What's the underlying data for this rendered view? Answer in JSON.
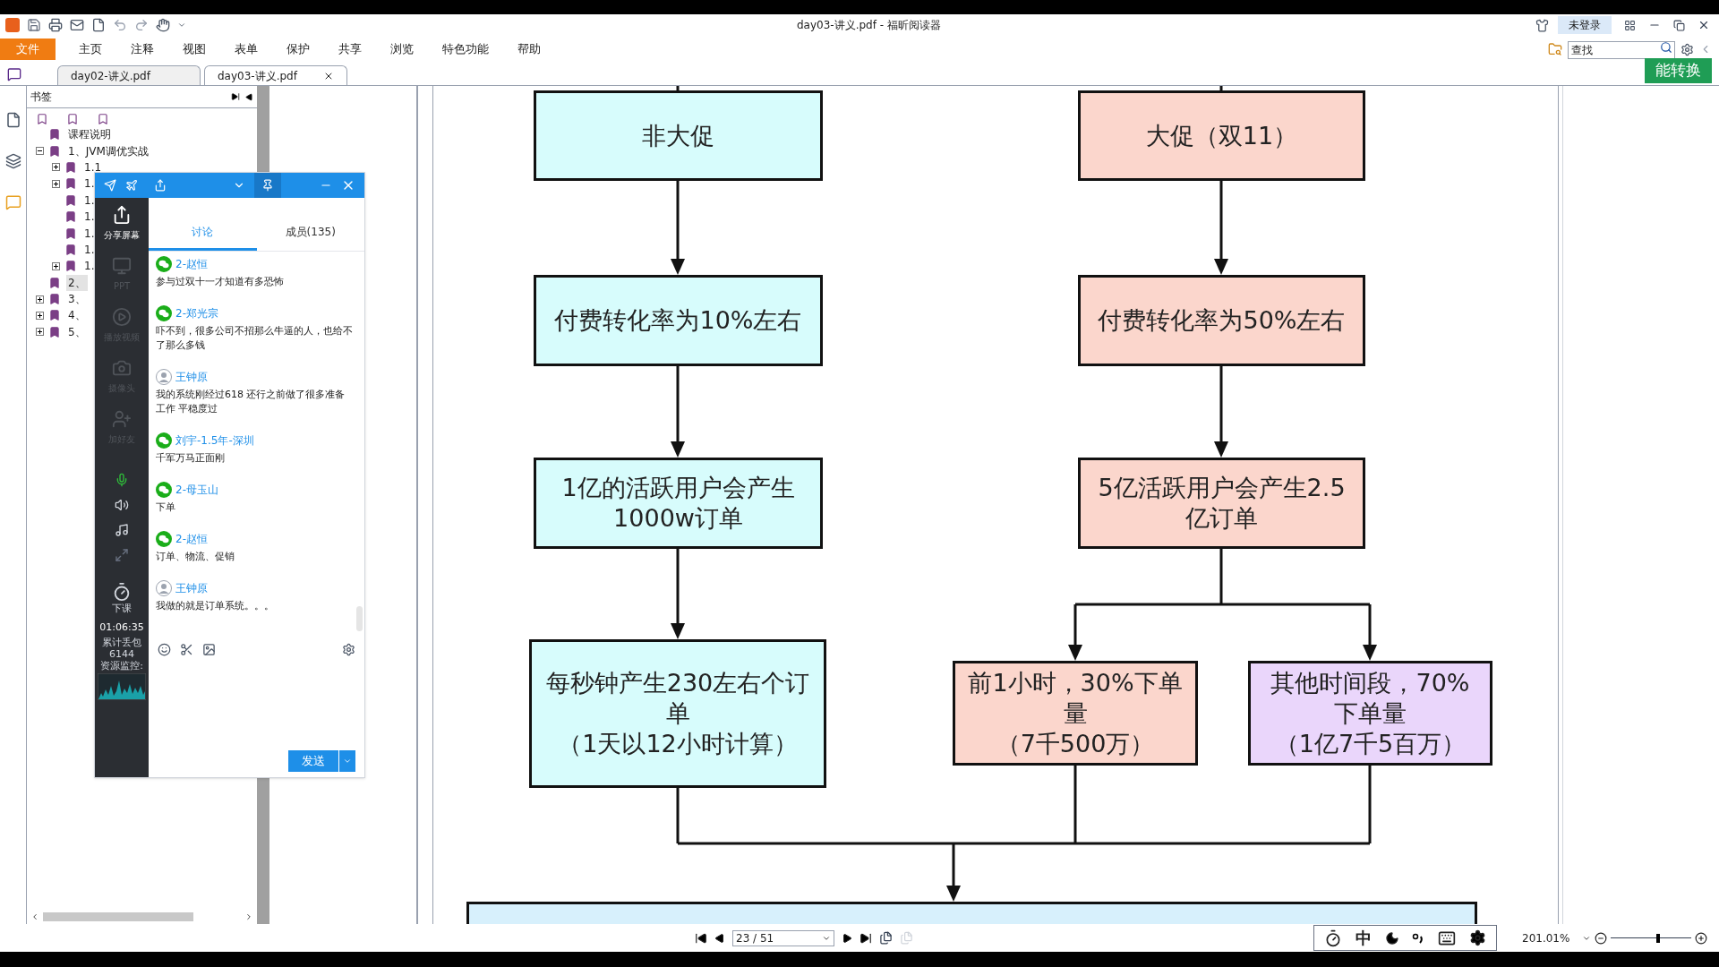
{
  "window": {
    "title": "day03-讲义.pdf - 福昕阅读器",
    "login": "未登录"
  },
  "menu": [
    {
      "label": "文件",
      "kind": "file"
    },
    {
      "label": "主页",
      "kind": "menu"
    },
    {
      "label": "注释",
      "kind": "menu"
    },
    {
      "label": "视图",
      "kind": "menu"
    },
    {
      "label": "表单",
      "kind": "menu"
    },
    {
      "label": "保护",
      "kind": "menu"
    },
    {
      "label": "共享",
      "kind": "menu"
    },
    {
      "label": "浏览",
      "kind": "menu"
    },
    {
      "label": "特色功能",
      "kind": "menu"
    },
    {
      "label": "帮助",
      "kind": "menu"
    }
  ],
  "search": {
    "placeholder": "查找"
  },
  "convert_button": "能转换",
  "doc_tabs": [
    {
      "label": "day02-讲义.pdf",
      "selected": false
    },
    {
      "label": "day03-讲义.pdf",
      "selected": true
    }
  ],
  "bookmarks": {
    "title": "书签",
    "items": [
      {
        "label": "课程说明",
        "expandable": false,
        "selected": false
      },
      {
        "label": "1、JVM调优实战",
        "expandable": true,
        "expanded": true,
        "selected": false,
        "children": [
          {
            "label": "1.1",
            "expandable": true,
            "expanded": false,
            "selected": false
          },
          {
            "label": "1.",
            "expandable": true,
            "expanded": false,
            "selected": false
          },
          {
            "label": "1.",
            "expandable": false,
            "selected": false
          },
          {
            "label": "1.",
            "expandable": false,
            "selected": false
          },
          {
            "label": "1.",
            "expandable": false,
            "selected": false
          },
          {
            "label": "1.",
            "expandable": false,
            "selected": false
          },
          {
            "label": "1.",
            "expandable": true,
            "expanded": false,
            "selected": false
          }
        ]
      },
      {
        "label": "2、",
        "expandable": false,
        "selected": true
      },
      {
        "label": "3、",
        "expandable": true,
        "expanded": false,
        "selected": false
      },
      {
        "label": "4、",
        "expandable": true,
        "expanded": false,
        "selected": false
      },
      {
        "label": "5、",
        "expandable": true,
        "expanded": false,
        "selected": false
      }
    ]
  },
  "chat": {
    "tabs": [
      {
        "label": "讨论",
        "selected": true
      },
      {
        "label": "成员(135)",
        "selected": false
      }
    ],
    "tools": [
      {
        "label": "分享屏幕",
        "kind": "share",
        "disabled": false
      },
      {
        "label": "PPT",
        "kind": "ppt",
        "disabled": true
      },
      {
        "label": "播放视频",
        "kind": "video",
        "disabled": true
      },
      {
        "label": "摄像头",
        "kind": "camera",
        "disabled": true
      },
      {
        "label": "加好友",
        "kind": "friend",
        "disabled": true
      }
    ],
    "end_class": "下课",
    "timer": "01:06:35",
    "packet_loss_label": "累计丢包",
    "packet_loss": "6144",
    "monitor_label": "资源监控:",
    "messages": [
      {
        "name": "2-赵恒",
        "kind": "wechat",
        "text": "参与过双十一才知道有多恐怖"
      },
      {
        "name": "2-郑光宗",
        "kind": "wechat",
        "text": "吓不到，很多公司不招那么牛逼的人，也给不了那么多钱"
      },
      {
        "name": "王钟原",
        "kind": "avatar",
        "text": "我的系统刚经过618 还行之前做了很多准备工作 平稳度过"
      },
      {
        "name": "刘宇-1.5年-深圳",
        "kind": "wechat",
        "text": "千军万马正面刚"
      },
      {
        "name": "2-母玉山",
        "kind": "wechat",
        "text": "下单"
      },
      {
        "name": "2-赵恒",
        "kind": "wechat",
        "text": "订单、物流、促销"
      },
      {
        "name": "王钟原",
        "kind": "avatar",
        "text": "我做的就是订单系统。。。"
      }
    ],
    "send": "发送"
  },
  "flowchart": {
    "nodes": [
      {
        "text": "非大促",
        "color": "#d7fcfc"
      },
      {
        "text": "大促（双11）",
        "color": "#fbd6cc"
      },
      {
        "text": "付费转化率为10%左右",
        "color": "#d7fcfc"
      },
      {
        "text": "付费转化率为50%左右",
        "color": "#fbd6cc"
      },
      {
        "text": "1亿的活跃用户会产生\n1000w订单",
        "color": "#d7fcfc"
      },
      {
        "text": "5亿活跃用户会产生2.5\n亿订单",
        "color": "#fbd6cc"
      },
      {
        "text": "每秒钟产生230左右个订单",
        "note": "（1天以12小时计算）",
        "color": "#d7fcfc"
      },
      {
        "text": "前1小时，30%下单量",
        "note": "（7千500万）",
        "color": "#fbd6cc"
      },
      {
        "text": "其他时间段，70%下单量",
        "note": "（1亿7千5百万）",
        "color": "#ead6fb"
      }
    ]
  },
  "status_bar": {
    "page": "23 / 51",
    "ime": "中",
    "zoom": "201.01%",
    "zoom_slider": {
      "level": 0.58
    }
  }
}
